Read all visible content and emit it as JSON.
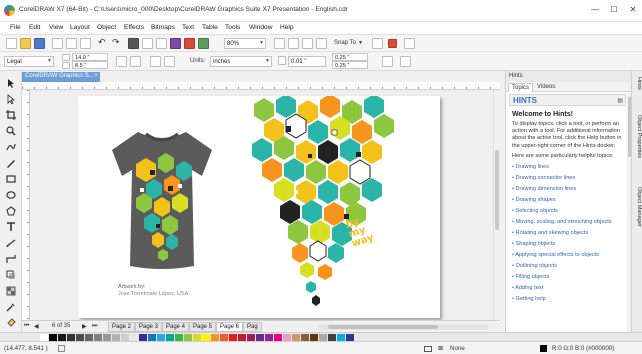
{
  "window": {
    "title": "CorelDRAW X7 (64-Bit) - C:\\Users\\micro_000\\Desktop\\CorelDRAW Graphics Suite X7 Presentation - English.cdr",
    "minimize": "—",
    "maximize": "☐",
    "close": "✕"
  },
  "menu": [
    "File",
    "Edit",
    "View",
    "Layout",
    "Object",
    "Effects",
    "Bitmaps",
    "Text",
    "Table",
    "Tools",
    "Window",
    "Help"
  ],
  "toolbar": {
    "zoom_value": "80%",
    "snap_to_label": "Snap To"
  },
  "property_bar": {
    "page_size": "Legal",
    "width": "14.0 \"",
    "height": "8.5 \"",
    "units_label": "Units:",
    "units_value": "inches",
    "nudge": "0.01 \"",
    "dup_x": "0.25 \"",
    "dup_y": "0.25 \""
  },
  "document_tab": {
    "label": "CorelDRAW Graphics S...",
    "close": "×"
  },
  "artwork": {
    "caption": "Artwork by:",
    "artist": "José Torretmate López, USA",
    "tagline": "by my way"
  },
  "page_nav": {
    "counter": "6 of 35",
    "pages": [
      "Page 2",
      "Page 3",
      "Page 4",
      "Page 5",
      "Page 6",
      "Pag"
    ],
    "active_page": "Page 6"
  },
  "status": {
    "coords": "(14.477, 8.541 )",
    "fill": "None",
    "color_readout": "R:0 G:0 B:0 (#000000)"
  },
  "palette": [
    "#ffffff",
    "#000000",
    "#1a1a1a",
    "#333333",
    "#4d4d4d",
    "#666666",
    "#808080",
    "#999999",
    "#b3b3b3",
    "#cccccc",
    "#e6e6e6",
    "#2e3192",
    "#1b75bc",
    "#27aae1",
    "#00a99d",
    "#39b54a",
    "#8dc63f",
    "#d7df23",
    "#fff200",
    "#f7941d",
    "#f15a29",
    "#ed1c24",
    "#be1e2d",
    "#9e1f63",
    "#662d91",
    "#92278f",
    "#ec008c",
    "#f49ac1",
    "#c69c6d",
    "#8b5e3c",
    "#603913",
    "#a7a9ac",
    "#414042",
    "#00aeef",
    "#2b3990"
  ],
  "hints": {
    "panel_title": "Hints",
    "tabs": [
      "Topics",
      "Videos"
    ],
    "heading": "HINTS",
    "welcome": "Welcome to Hints!",
    "intro": "To display topics, click a tool, or perform an action with a tool. For additional information about the active tool, click the Help button in the upper-right corner of the Hints docker.",
    "intro2": "Here are some particularly helpful topics:",
    "links": [
      "• Drawing lines",
      "• Drawing connector lines",
      "• Drawing dimension lines",
      "• Drawing shapes",
      "• Selecting objects",
      "• Moving, scaling, and stretching objects",
      "• Rotating and skewing objects",
      "• Shaping objects",
      "• Applying special effects to objects",
      "• Outlining objects",
      "• Filling objects",
      "• Adding text",
      "• Getting help"
    ]
  },
  "side_tabs": [
    "Hints",
    "Object Properties",
    "Object Manager"
  ]
}
